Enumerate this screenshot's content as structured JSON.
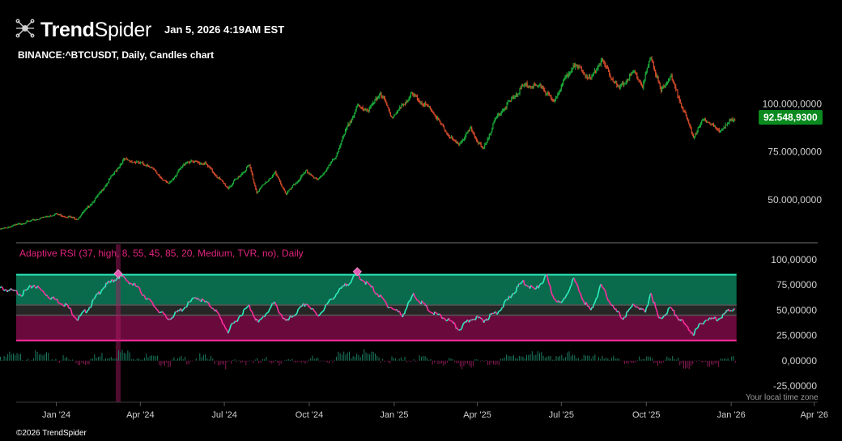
{
  "header": {
    "brand_bold": "Trend",
    "brand_light": "Spider",
    "timestamp": "Jan 5, 2026 4:19AM EST",
    "symbol_line": "BINANCE:^BTCUSDT, Daily, Candles chart",
    "copyright": "©2026 TrendSpider",
    "timezone_note": "Your local time zone"
  },
  "colors": {
    "up_candle": "#1aa83a",
    "down_candle": "#d04a2a",
    "overbought_zone": "#0a6a4c",
    "oversold_zone": "#6a0a3c",
    "neutral_band": "#262626",
    "rsi_up": "#2ef0c0",
    "rsi_down": "#ff2da0",
    "upper_line": "#2ef0c0",
    "lower_line": "#ff2da0",
    "price_badge": "#0b8a1f"
  },
  "chart_data": [
    {
      "type": "candlestick",
      "title": "BINANCE:^BTCUSDT, Daily, Candles chart",
      "last_price_label": "92.548,9300",
      "y_ticks": [
        "100.000,0000",
        "75.000,0000",
        "50.000,0000"
      ],
      "y_tick_values": [
        100000,
        75000,
        50000
      ],
      "ylim": [
        27500,
        129000
      ],
      "x_ticks": [
        "Jan '24",
        "Apr '24",
        "Jul '24",
        "Oct '24",
        "Jan '25",
        "Apr '25",
        "Jul '25",
        "Oct '25",
        "Jan '26",
        "Apr '26"
      ],
      "xlim": [
        "2023-11-01",
        "2026-05-01"
      ],
      "close_path": [
        {
          "date": "2023-11-01",
          "close": 34500
        },
        {
          "date": "2023-12-01",
          "close": 38500
        },
        {
          "date": "2023-12-31",
          "close": 42500
        },
        {
          "date": "2024-01-24",
          "close": 40000
        },
        {
          "date": "2024-02-15",
          "close": 52000
        },
        {
          "date": "2024-03-14",
          "close": 71000
        },
        {
          "date": "2024-04-10",
          "close": 68000
        },
        {
          "date": "2024-05-01",
          "close": 58000
        },
        {
          "date": "2024-05-21",
          "close": 70000
        },
        {
          "date": "2024-06-10",
          "close": 69000
        },
        {
          "date": "2024-07-05",
          "close": 56000
        },
        {
          "date": "2024-07-28",
          "close": 68000
        },
        {
          "date": "2024-08-05",
          "close": 54000
        },
        {
          "date": "2024-08-25",
          "close": 64000
        },
        {
          "date": "2024-09-06",
          "close": 53000
        },
        {
          "date": "2024-09-28",
          "close": 65000
        },
        {
          "date": "2024-10-10",
          "close": 60000
        },
        {
          "date": "2024-10-29",
          "close": 72000
        },
        {
          "date": "2024-11-13",
          "close": 90000
        },
        {
          "date": "2024-11-22",
          "close": 98500
        },
        {
          "date": "2024-12-05",
          "close": 97000
        },
        {
          "date": "2024-12-17",
          "close": 106000
        },
        {
          "date": "2024-12-30",
          "close": 93000
        },
        {
          "date": "2025-01-20",
          "close": 105000
        },
        {
          "date": "2025-02-10",
          "close": 97000
        },
        {
          "date": "2025-02-28",
          "close": 84000
        },
        {
          "date": "2025-03-11",
          "close": 78500
        },
        {
          "date": "2025-03-25",
          "close": 87000
        },
        {
          "date": "2025-04-07",
          "close": 76000
        },
        {
          "date": "2025-04-22",
          "close": 93500
        },
        {
          "date": "2025-05-22",
          "close": 110000
        },
        {
          "date": "2025-06-10",
          "close": 109000
        },
        {
          "date": "2025-06-22",
          "close": 101000
        },
        {
          "date": "2025-07-14",
          "close": 121000
        },
        {
          "date": "2025-08-02",
          "close": 113000
        },
        {
          "date": "2025-08-13",
          "close": 123000
        },
        {
          "date": "2025-09-01",
          "close": 108000
        },
        {
          "date": "2025-09-18",
          "close": 117000
        },
        {
          "date": "2025-09-27",
          "close": 109000
        },
        {
          "date": "2025-10-06",
          "close": 125000
        },
        {
          "date": "2025-10-17",
          "close": 106500
        },
        {
          "date": "2025-10-27",
          "close": 115000
        },
        {
          "date": "2025-11-21",
          "close": 83000
        },
        {
          "date": "2025-12-03",
          "close": 92500
        },
        {
          "date": "2025-12-18",
          "close": 86000
        },
        {
          "date": "2026-01-05",
          "close": 92549
        }
      ]
    },
    {
      "type": "line",
      "title": "Adaptive RSI (37, high, 8, 55, 45, 85, 20, Medium, TVR, no), Daily",
      "y_ticks": [
        "100,00000",
        "75,00000",
        "50,00000",
        "25,00000",
        "0,00000",
        "-25,00000"
      ],
      "y_tick_values": [
        100,
        75,
        50,
        25,
        0,
        -25
      ],
      "ylim": [
        -41,
        115
      ],
      "levels": {
        "upper": 85,
        "mid_high": 55,
        "mid_low": 45,
        "lower": 20
      },
      "signal_date": "2024-03-08",
      "peak_markers": [
        {
          "date": "2024-03-08",
          "value": 86
        },
        {
          "date": "2024-11-22",
          "value": 88
        }
      ],
      "rsi_path": [
        {
          "date": "2023-11-01",
          "value": 72
        },
        {
          "date": "2023-11-25",
          "value": 66
        },
        {
          "date": "2023-12-08",
          "value": 75
        },
        {
          "date": "2023-12-25",
          "value": 63
        },
        {
          "date": "2024-01-12",
          "value": 55
        },
        {
          "date": "2024-01-24",
          "value": 41
        },
        {
          "date": "2024-02-05",
          "value": 52
        },
        {
          "date": "2024-02-20",
          "value": 72
        },
        {
          "date": "2024-03-10",
          "value": 84
        },
        {
          "date": "2024-03-28",
          "value": 73
        },
        {
          "date": "2024-04-15",
          "value": 55
        },
        {
          "date": "2024-05-01",
          "value": 41
        },
        {
          "date": "2024-05-15",
          "value": 50
        },
        {
          "date": "2024-06-01",
          "value": 63
        },
        {
          "date": "2024-06-20",
          "value": 52
        },
        {
          "date": "2024-07-05",
          "value": 29
        },
        {
          "date": "2024-07-20",
          "value": 47
        },
        {
          "date": "2024-07-28",
          "value": 54
        },
        {
          "date": "2024-08-07",
          "value": 37
        },
        {
          "date": "2024-08-24",
          "value": 57
        },
        {
          "date": "2024-09-06",
          "value": 38
        },
        {
          "date": "2024-09-28",
          "value": 57
        },
        {
          "date": "2024-10-10",
          "value": 44
        },
        {
          "date": "2024-10-30",
          "value": 66
        },
        {
          "date": "2024-11-22",
          "value": 85
        },
        {
          "date": "2024-12-10",
          "value": 70
        },
        {
          "date": "2024-12-25",
          "value": 55
        },
        {
          "date": "2025-01-10",
          "value": 45
        },
        {
          "date": "2025-01-22",
          "value": 65
        },
        {
          "date": "2025-02-10",
          "value": 48
        },
        {
          "date": "2025-03-01",
          "value": 40
        },
        {
          "date": "2025-03-12",
          "value": 31
        },
        {
          "date": "2025-03-28",
          "value": 43
        },
        {
          "date": "2025-04-08",
          "value": 40
        },
        {
          "date": "2025-04-25",
          "value": 50
        },
        {
          "date": "2025-05-20",
          "value": 78
        },
        {
          "date": "2025-06-03",
          "value": 70
        },
        {
          "date": "2025-06-15",
          "value": 83
        },
        {
          "date": "2025-06-22",
          "value": 64
        },
        {
          "date": "2025-07-01",
          "value": 55
        },
        {
          "date": "2025-07-14",
          "value": 81
        },
        {
          "date": "2025-07-25",
          "value": 60
        },
        {
          "date": "2025-08-02",
          "value": 49
        },
        {
          "date": "2025-08-13",
          "value": 74
        },
        {
          "date": "2025-08-28",
          "value": 50
        },
        {
          "date": "2025-09-06",
          "value": 42
        },
        {
          "date": "2025-09-18",
          "value": 56
        },
        {
          "date": "2025-09-30",
          "value": 47
        },
        {
          "date": "2025-10-06",
          "value": 68
        },
        {
          "date": "2025-10-15",
          "value": 40
        },
        {
          "date": "2025-10-27",
          "value": 52
        },
        {
          "date": "2025-11-12",
          "value": 35
        },
        {
          "date": "2025-11-21",
          "value": 27
        },
        {
          "date": "2025-12-03",
          "value": 40
        },
        {
          "date": "2025-12-18",
          "value": 42
        },
        {
          "date": "2026-01-05",
          "value": 53
        }
      ]
    }
  ]
}
